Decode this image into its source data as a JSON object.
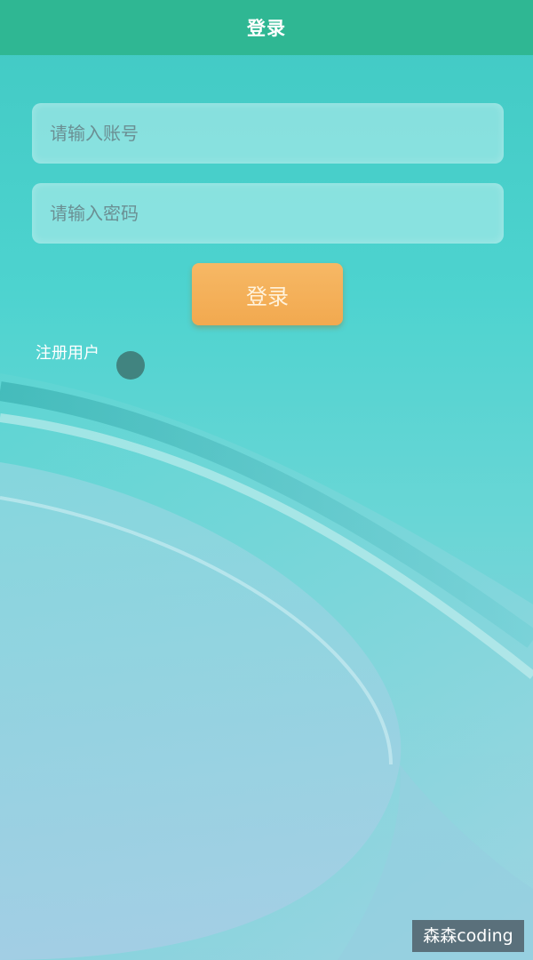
{
  "navbar": {
    "title": "登录"
  },
  "form": {
    "account_placeholder": "请输入账号",
    "password_placeholder": "请输入密码",
    "login_button": "登录",
    "register_link": "注册用户"
  },
  "watermark": {
    "text": "森森coding"
  },
  "colors": {
    "navbar": "#2fb793",
    "button": "#f2a94f",
    "background_top": "#41c9c3",
    "background_bottom": "#9ec8e2"
  }
}
